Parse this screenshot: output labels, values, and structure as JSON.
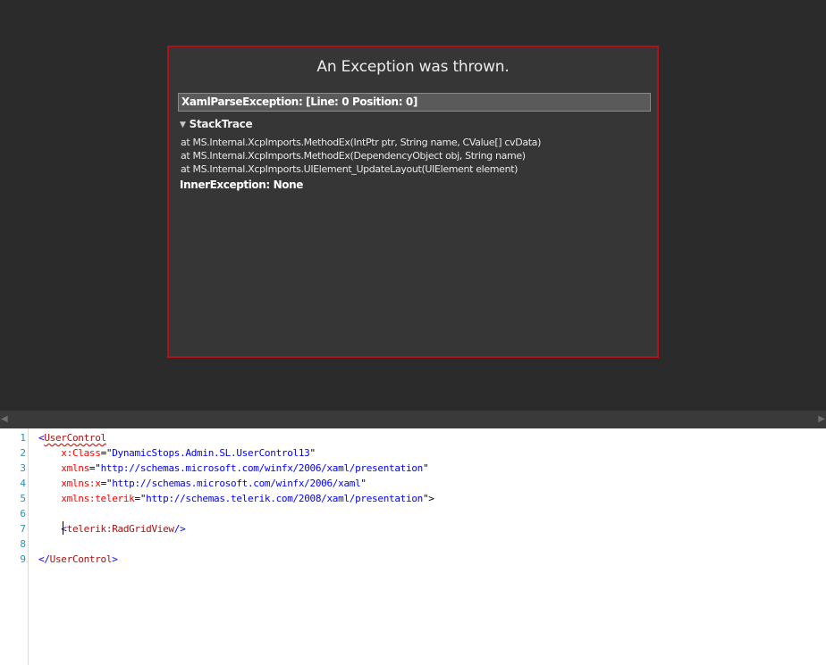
{
  "designer": {
    "exception": {
      "title": "An Exception was thrown.",
      "header": "XamlParseException:  [Line: 0 Position: 0]",
      "stacktrace_label": "StackTrace",
      "stack_lines": [
        "at MS.Internal.XcpImports.MethodEx(IntPtr ptr, String name, CValue[] cvData)",
        "at MS.Internal.XcpImports.MethodEx(DependencyObject obj, String name)",
        "at MS.Internal.XcpImports.UIElement_UpdateLayout(UIElement element)"
      ],
      "inner_exception": "InnerException: None"
    },
    "colors": {
      "panel_border": "#b01018",
      "background": "#2b2b2b"
    }
  },
  "editor": {
    "line_numbers": [
      "1",
      "2",
      "3",
      "4",
      "5",
      "6",
      "7",
      "8",
      "9"
    ],
    "lines": {
      "l1_open": "<",
      "l1_tag": "UserControl",
      "l2_indent": "    ",
      "l2_attr": "x:Class",
      "l2_eq": "=\"",
      "l2_val": "DynamicStops.Admin.SL.UserControl13",
      "l2_close": "\"",
      "l3_indent": "    ",
      "l3_attr": "xmlns",
      "l3_eq": "=\"",
      "l3_val": "http://schemas.microsoft.com/winfx/2006/xaml/presentation",
      "l3_close": "\"",
      "l4_indent": "    ",
      "l4_attr": "xmlns:x",
      "l4_eq": "=\"",
      "l4_val": "http://schemas.microsoft.com/winfx/2006/xaml",
      "l4_close": "\"",
      "l5_indent": "    ",
      "l5_attr": "xmlns:telerik",
      "l5_eq": "=\"",
      "l5_val": "http://schemas.telerik.com/2008/xaml/presentation",
      "l5_close": "\">",
      "l7_indent": "    ",
      "l7_open": "<",
      "l7_tag": "telerik:RadGridView",
      "l7_close": "/>",
      "l9_open": "</",
      "l9_tag": "UserControl",
      "l9_close": ">"
    }
  },
  "scrollbar": {
    "left_arrow": "◀",
    "right_arrow": "▶"
  },
  "icons": {
    "stacktrace_toggle": "▼"
  }
}
